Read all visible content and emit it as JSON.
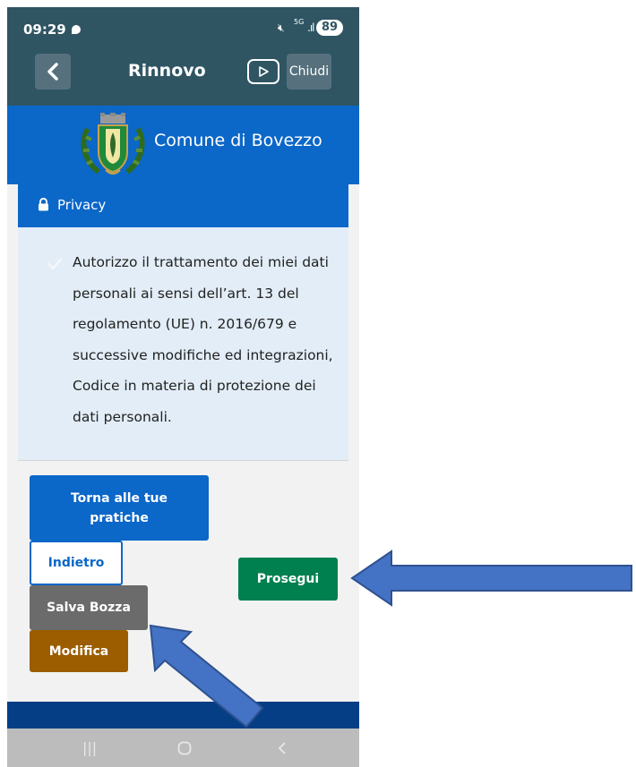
{
  "status_bar": {
    "time": "09:29",
    "network": "5G",
    "battery": "89"
  },
  "app_bar": {
    "title": "Rinnovo",
    "close_label": "Chiudi"
  },
  "municipality": {
    "name": "Comune di Bovezzo"
  },
  "privacy": {
    "header": "Privacy",
    "text": "Autorizzo il trattamento dei miei dati personali ai sensi dell’art. 13 del regolamento (UE) n. 2016/679 e successive modifiche ed integrazioni, Codice in materia di protezione dei dati personali.",
    "checked": true
  },
  "actions": {
    "torna_label": "Torna alle tue pratiche",
    "indietro_label": "Indietro",
    "salva_label": "Salva Bozza",
    "modifica_label": "Modifica",
    "prosegui_label": "Prosegui"
  },
  "colors": {
    "primary": "#0b67c8",
    "appbar": "#2f5563",
    "success": "#00804f",
    "warning": "#9b5d00",
    "arrow": "#4472c4"
  }
}
